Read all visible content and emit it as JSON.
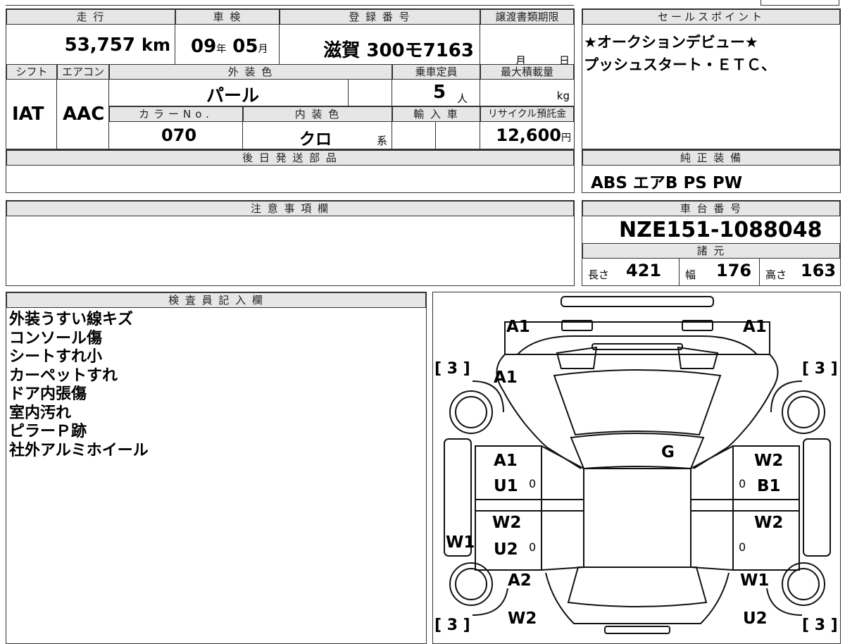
{
  "labels": {
    "mileage": "走 行",
    "shaken": "車 検",
    "reg": "登 録 番 号",
    "doc_deadline": "譲渡書類期限",
    "sales_point": "セールスポイント",
    "shift": "シフト",
    "aircon": "エアコン",
    "exterior_color": "外 装 色",
    "capacity": "乗車定員",
    "max_load": "最大積載量",
    "color_no": "カラーNo.",
    "interior_color": "内 装 色",
    "import": "輸 入 車",
    "recycle": "リサイクル預託金",
    "later_parts": "後 日 発 送 部 品",
    "genuine_equipment": "純 正 装 備",
    "notes": "注 意 事 項 欄",
    "chassis_no": "車 台 番 号",
    "specs": "諸 元",
    "inspector": "検 査 員 記 入 欄",
    "length": "長さ",
    "width": "幅",
    "height": "高さ"
  },
  "vehicle": {
    "mileage": "53,757",
    "mileage_unit": "km",
    "shaken_year": "09",
    "shaken_year_unit": "年",
    "shaken_month": "05",
    "shaken_month_unit": "月",
    "registration": "滋賀 300モ7163",
    "doc_month_unit": "月",
    "doc_day_unit": "日",
    "shift": "IAT",
    "aircon": "AAC",
    "exterior_color": "パール",
    "capacity": "5",
    "capacity_unit": "人",
    "max_load_unit": "kg",
    "color_no": "070",
    "interior_color": "クロ",
    "interior_suffix": "系",
    "recycle_fee": "12,600",
    "recycle_unit": "円",
    "equipment": "ABS エアB PS PW",
    "chassis_no": "NZE151-1088048",
    "length": "421",
    "width": "176",
    "height": "163"
  },
  "sales_points": [
    "★オークションデビュー★",
    "プッシュスタート・ＥＴＣ、"
  ],
  "inspector_notes": [
    "外装うすい線キズ",
    "コンソール傷",
    "シートすれ小",
    "カーペットすれ",
    "ドア内張傷",
    "室内汚れ",
    "ピラーＰ跡",
    "社外アルミホイール"
  ],
  "condition_marks": {
    "front_left": "A1",
    "front_right": "A1",
    "hood": "A1",
    "windshield": "G",
    "front_door_left_1": "A1",
    "front_door_left_2": "U1",
    "front_door_right_1": "W2",
    "front_door_right_2": "B1",
    "rear_door_left_1": "W2",
    "rear_door_left_2": "U2",
    "rear_door_right": "W2",
    "sill_left": "W1",
    "rear_fender_left": "A2",
    "rear_fender_right": "W1",
    "rear_left": "W2",
    "rear_right": "U2",
    "tire_front_left": "[ 3 ]",
    "tire_front_right": "[ 3 ]",
    "tire_rear_left": "[ 3 ]",
    "tire_rear_right": "[ 3 ]",
    "zero_marks": [
      "0",
      "0",
      "0",
      "0"
    ]
  }
}
